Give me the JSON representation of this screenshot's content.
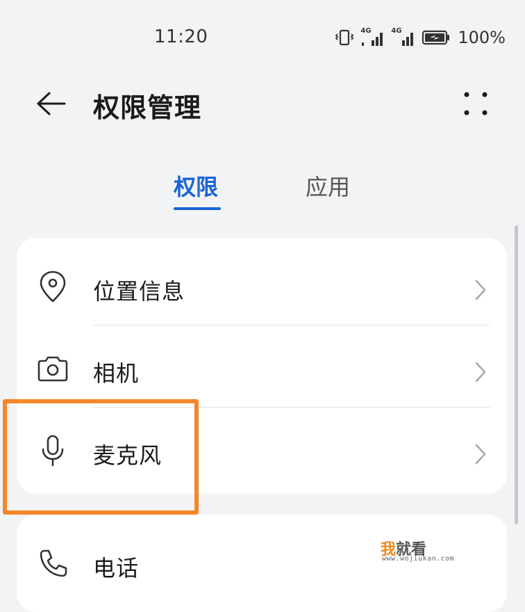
{
  "status_bar": {
    "time": "11:20",
    "network_1": "4G",
    "network_2": "4G",
    "battery_percent": "100%",
    "icons": [
      "vibrate-icon",
      "signal-icon",
      "signal-icon",
      "battery-charging-icon"
    ]
  },
  "header": {
    "title": "权限管理",
    "back_icon": "arrow-left-icon",
    "more_icon": "more-dots-icon"
  },
  "tabs": [
    {
      "label": "权限",
      "active": true
    },
    {
      "label": "应用",
      "active": false
    }
  ],
  "permissions": [
    {
      "label": "位置信息",
      "icon": "location-pin-icon"
    },
    {
      "label": "相机",
      "icon": "camera-icon"
    },
    {
      "label": "麦克风",
      "icon": "microphone-icon"
    },
    {
      "label": "电话",
      "icon": "phone-icon"
    }
  ],
  "watermark": {
    "first_char": "我",
    "rest": "就看",
    "url": "www.wojiukan.com"
  },
  "colors": {
    "accent": "#1a63d6",
    "highlight": "#f5872a",
    "background": "#f1f3f5",
    "card": "#ffffff"
  }
}
